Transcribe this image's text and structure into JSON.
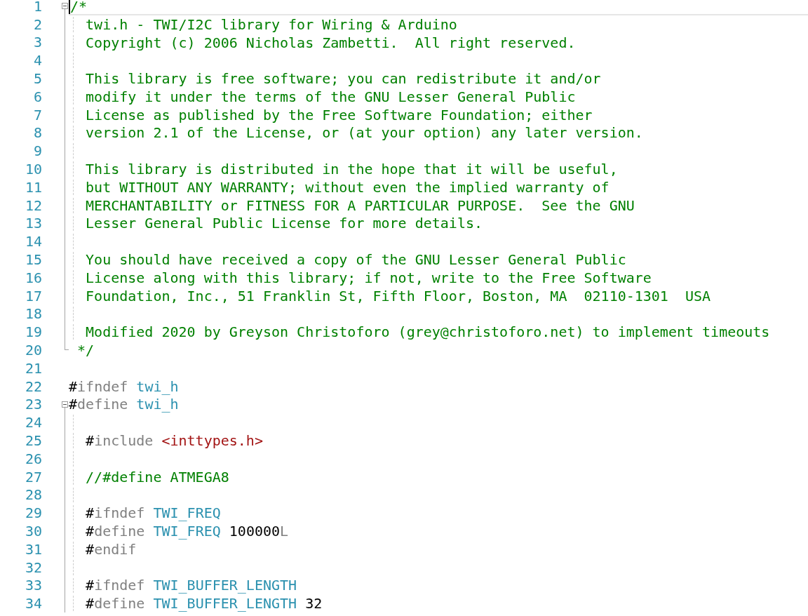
{
  "editor": {
    "lines": [
      {
        "number": "1",
        "collapsible": true,
        "folded_region": true,
        "current": true,
        "tokens": [
          {
            "kind": "comment",
            "text": "/*"
          }
        ]
      },
      {
        "number": "2",
        "collapsible": false,
        "folded_region": true,
        "current": false,
        "tokens": [
          {
            "kind": "comment",
            "text": "  twi.h - TWI/I2C library for Wiring & Arduino"
          }
        ]
      },
      {
        "number": "3",
        "collapsible": false,
        "folded_region": true,
        "current": false,
        "tokens": [
          {
            "kind": "comment",
            "text": "  Copyright (c) 2006 Nicholas Zambetti.  All right reserved."
          }
        ]
      },
      {
        "number": "4",
        "collapsible": false,
        "folded_region": true,
        "current": false
      },
      {
        "number": "5",
        "collapsible": false,
        "folded_region": true,
        "current": false,
        "tokens": [
          {
            "kind": "comment",
            "text": "  This library is free software; you can redistribute it and/or"
          }
        ]
      },
      {
        "number": "6",
        "collapsible": false,
        "folded_region": true,
        "current": false,
        "tokens": [
          {
            "kind": "comment",
            "text": "  modify it under the terms of the GNU Lesser General Public"
          }
        ]
      },
      {
        "number": "7",
        "collapsible": false,
        "folded_region": true,
        "current": false,
        "tokens": [
          {
            "kind": "comment",
            "text": "  License as published by the Free Software Foundation; either"
          }
        ]
      },
      {
        "number": "8",
        "collapsible": false,
        "folded_region": true,
        "current": false,
        "tokens": [
          {
            "kind": "comment",
            "text": "  version 2.1 of the License, or (at your option) any later version."
          }
        ]
      },
      {
        "number": "9",
        "collapsible": false,
        "folded_region": true,
        "current": false
      },
      {
        "number": "10",
        "collapsible": false,
        "folded_region": true,
        "current": false,
        "tokens": [
          {
            "kind": "comment",
            "text": "  This library is distributed in the hope that it will be useful,"
          }
        ]
      },
      {
        "number": "11",
        "collapsible": false,
        "folded_region": true,
        "current": false,
        "tokens": [
          {
            "kind": "comment",
            "text": "  but WITHOUT ANY WARRANTY; without even the implied warranty of"
          }
        ]
      },
      {
        "number": "12",
        "collapsible": false,
        "folded_region": true,
        "current": false,
        "tokens": [
          {
            "kind": "comment",
            "text": "  MERCHANTABILITY or FITNESS FOR A PARTICULAR PURPOSE.  See the GNU"
          }
        ]
      },
      {
        "number": "13",
        "collapsible": false,
        "folded_region": true,
        "current": false,
        "tokens": [
          {
            "kind": "comment",
            "text": "  Lesser General Public License for more details."
          }
        ]
      },
      {
        "number": "14",
        "collapsible": false,
        "folded_region": true,
        "current": false
      },
      {
        "number": "15",
        "collapsible": false,
        "folded_region": true,
        "current": false,
        "tokens": [
          {
            "kind": "comment",
            "text": "  You should have received a copy of the GNU Lesser General Public"
          }
        ]
      },
      {
        "number": "16",
        "collapsible": false,
        "folded_region": true,
        "current": false,
        "tokens": [
          {
            "kind": "comment",
            "text": "  License along with this library; if not, write to the Free Software"
          }
        ]
      },
      {
        "number": "17",
        "collapsible": false,
        "folded_region": true,
        "current": false,
        "tokens": [
          {
            "kind": "comment",
            "text": "  Foundation, Inc., 51 Franklin St, Fifth Floor, Boston, MA  02110-1301  USA"
          }
        ]
      },
      {
        "number": "18",
        "collapsible": false,
        "folded_region": true,
        "current": false
      },
      {
        "number": "19",
        "collapsible": false,
        "folded_region": true,
        "current": false,
        "tokens": [
          {
            "kind": "comment",
            "text": "  Modified 2020 by Greyson Christoforo (grey@christoforo.net) to implement timeouts"
          }
        ]
      },
      {
        "number": "20",
        "collapsible": false,
        "folded_region": true,
        "current": false,
        "tokens": [
          {
            "kind": "comment",
            "text": " */"
          }
        ]
      },
      {
        "number": "21",
        "collapsible": false,
        "folded_region": false,
        "current": false
      },
      {
        "number": "22",
        "collapsible": false,
        "folded_region": false,
        "current": false,
        "tokens": [
          {
            "kind": "hash",
            "text": "#"
          },
          {
            "kind": "directive",
            "text": "ifndef "
          },
          {
            "kind": "macro",
            "text": "twi_h"
          }
        ]
      },
      {
        "number": "23",
        "collapsible": true,
        "folded_region": true,
        "current": false,
        "tokens": [
          {
            "kind": "hash",
            "text": "#"
          },
          {
            "kind": "directive",
            "text": "define "
          },
          {
            "kind": "macro",
            "text": "twi_h"
          }
        ]
      },
      {
        "number": "24",
        "collapsible": false,
        "folded_region": true,
        "current": false
      },
      {
        "number": "25",
        "collapsible": false,
        "folded_region": true,
        "current": false,
        "tokens": [
          {
            "kind": "hash",
            "text": "  #"
          },
          {
            "kind": "directive",
            "text": "include "
          },
          {
            "kind": "string",
            "text": "<inttypes.h>"
          }
        ]
      },
      {
        "number": "26",
        "collapsible": false,
        "folded_region": true,
        "current": false
      },
      {
        "number": "27",
        "collapsible": false,
        "folded_region": true,
        "current": false,
        "tokens": [
          {
            "kind": "comment",
            "text": "  //#define ATMEGA8"
          }
        ]
      },
      {
        "number": "28",
        "collapsible": false,
        "folded_region": true,
        "current": false
      },
      {
        "number": "29",
        "collapsible": false,
        "folded_region": true,
        "current": false,
        "tokens": [
          {
            "kind": "hash",
            "text": "  #"
          },
          {
            "kind": "directive",
            "text": "ifndef "
          },
          {
            "kind": "macro",
            "text": "TWI_FREQ"
          }
        ]
      },
      {
        "number": "30",
        "collapsible": false,
        "folded_region": true,
        "current": false,
        "tokens": [
          {
            "kind": "hash",
            "text": "  #"
          },
          {
            "kind": "directive",
            "text": "define "
          },
          {
            "kind": "macro",
            "text": "TWI_FREQ "
          },
          {
            "kind": "number",
            "text": "100000"
          },
          {
            "kind": "directive",
            "text": "L"
          }
        ]
      },
      {
        "number": "31",
        "collapsible": false,
        "folded_region": true,
        "current": false,
        "tokens": [
          {
            "kind": "hash",
            "text": "  #"
          },
          {
            "kind": "directive",
            "text": "endif"
          }
        ]
      },
      {
        "number": "32",
        "collapsible": false,
        "folded_region": true,
        "current": false
      },
      {
        "number": "33",
        "collapsible": false,
        "folded_region": true,
        "current": false,
        "tokens": [
          {
            "kind": "hash",
            "text": "  #"
          },
          {
            "kind": "directive",
            "text": "ifndef "
          },
          {
            "kind": "macro",
            "text": "TWI_BUFFER_LENGTH"
          }
        ]
      },
      {
        "number": "34",
        "collapsible": false,
        "folded_region": true,
        "current": false,
        "tokens": [
          {
            "kind": "hash",
            "text": "  #"
          },
          {
            "kind": "directive",
            "text": "define "
          },
          {
            "kind": "macro",
            "text": "TWI_BUFFER_LENGTH "
          },
          {
            "kind": "number",
            "text": "32"
          }
        ]
      }
    ]
  }
}
